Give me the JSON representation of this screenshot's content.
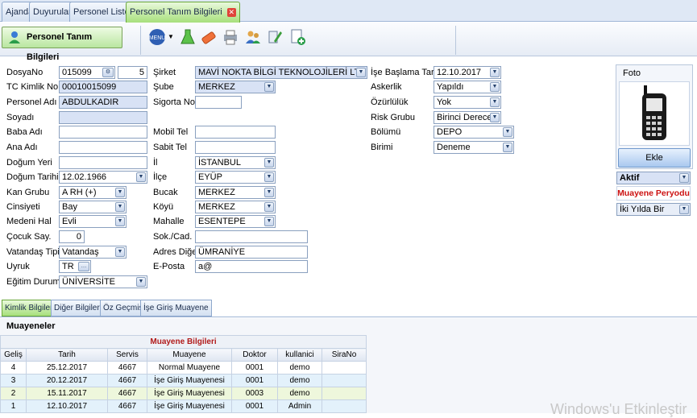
{
  "tabs": [
    {
      "label": "Ajanda"
    },
    {
      "label": "Duyurular"
    },
    {
      "label": "Personel Listesi"
    },
    {
      "label": "Personel Tanım Bilgileri"
    }
  ],
  "toolbar": {
    "title": "Personel Tanım Bilgileri",
    "icons": [
      "menu-icon",
      "flask-icon",
      "eraser-icon",
      "printer-icon",
      "users-icon",
      "edit-icon",
      "new-document-icon"
    ]
  },
  "form": {
    "col1": [
      {
        "label": "DosyaNo",
        "value": "015099",
        "value2": "5"
      },
      {
        "label": "TC Kimlik No",
        "value": "00010015099"
      },
      {
        "label": "Personel Adı",
        "value": "ABDULKADIR"
      },
      {
        "label": "Soyadı",
        "value": ""
      },
      {
        "label": "Baba Adı",
        "value": ""
      },
      {
        "label": "Ana Adı",
        "value": ""
      },
      {
        "label": "Doğum Yeri",
        "value": ""
      },
      {
        "label": "Doğum Tarihi",
        "value": "12.02.1966"
      },
      {
        "label": "Kan Grubu",
        "value": "A RH (+)"
      },
      {
        "label": "Cinsiyeti",
        "value": "Bay"
      },
      {
        "label": "Medeni Hal",
        "value": "Evli"
      },
      {
        "label": "Çocuk Say.",
        "value": "0"
      },
      {
        "label": "Vatandaş Tipi",
        "value": "Vatandaş"
      },
      {
        "label": "Uyruk",
        "value": "TR"
      },
      {
        "label": "Eğitim Durumu",
        "value": "ÜNİVERSİTE"
      }
    ],
    "col2": [
      {
        "label": "Şirket",
        "value": "MAVİ NOKTA BİLGİ TEKNOLOJİLERİ LTD.ŞTİ."
      },
      {
        "label": "Şube",
        "value": "MERKEZ"
      },
      {
        "label": "Sigorta No",
        "value": ""
      },
      {
        "label": "Mobil Tel",
        "value": ""
      },
      {
        "label": "Sabit Tel",
        "value": ""
      },
      {
        "label": "İl",
        "value": "İSTANBUL"
      },
      {
        "label": "İlçe",
        "value": "EYÜP"
      },
      {
        "label": "Bucak",
        "value": "MERKEZ"
      },
      {
        "label": "Köyü",
        "value": "MERKEZ"
      },
      {
        "label": "Mahalle",
        "value": "ESENTEPE"
      },
      {
        "label": "Sok./Cad.",
        "value": ""
      },
      {
        "label": "Adres Diğer",
        "value": "ÜMRANİYE"
      },
      {
        "label": "E-Posta",
        "value": "a@"
      }
    ],
    "col3": [
      {
        "label": "İşe Başlama Tarihi",
        "value": "12.10.2017"
      },
      {
        "label": "Askerlik",
        "value": "Yapıldı"
      },
      {
        "label": "Özürlülük",
        "value": "Yok"
      },
      {
        "label": "Risk Grubu",
        "value": "Birinci Derece"
      },
      {
        "label": "Bölümü",
        "value": "DEPO"
      },
      {
        "label": "Birimi",
        "value": "Deneme"
      }
    ]
  },
  "foto": {
    "title": "Foto",
    "add_label": "Ekle",
    "status": "Aktif",
    "muayene_label": "Muayene Peryodu",
    "period": "İki Yılda Bir"
  },
  "bottom_tabs": [
    {
      "label": "Kimlik Bilgileri"
    },
    {
      "label": "Diğer Bilgileri"
    },
    {
      "label": "Öz Geçmiş"
    },
    {
      "label": "İşe Giriş Muayene"
    }
  ],
  "muayeneler": {
    "section_title": "Muayeneler",
    "table_title": "Muayene Bilgileri",
    "columns": [
      "Geliş",
      "Tarih",
      "Servis",
      "Muayene",
      "Doktor",
      "kullanici",
      "SiraNo"
    ],
    "rows": [
      [
        "4",
        "25.12.2017",
        "4667",
        "Normal Muayene",
        "0001",
        "demo",
        ""
      ],
      [
        "3",
        "20.12.2017",
        "4667",
        "İşe Giriş Muayenesi",
        "0001",
        "demo",
        ""
      ],
      [
        "2",
        "15.11.2017",
        "4667",
        "İşe Giriş Muayenesi",
        "0003",
        "demo",
        ""
      ],
      [
        "1",
        "12.10.2017",
        "4667",
        "İşe Giriş Muayenesi",
        "0001",
        "Admin",
        ""
      ]
    ]
  },
  "watermark": "Windows'u Etkinleştir",
  "colors": {
    "accent_green": "#a7e07c",
    "header_blue": "#dfe8f5",
    "field_blue": "#d8e2f5",
    "muayene_red": "#cc1111"
  }
}
